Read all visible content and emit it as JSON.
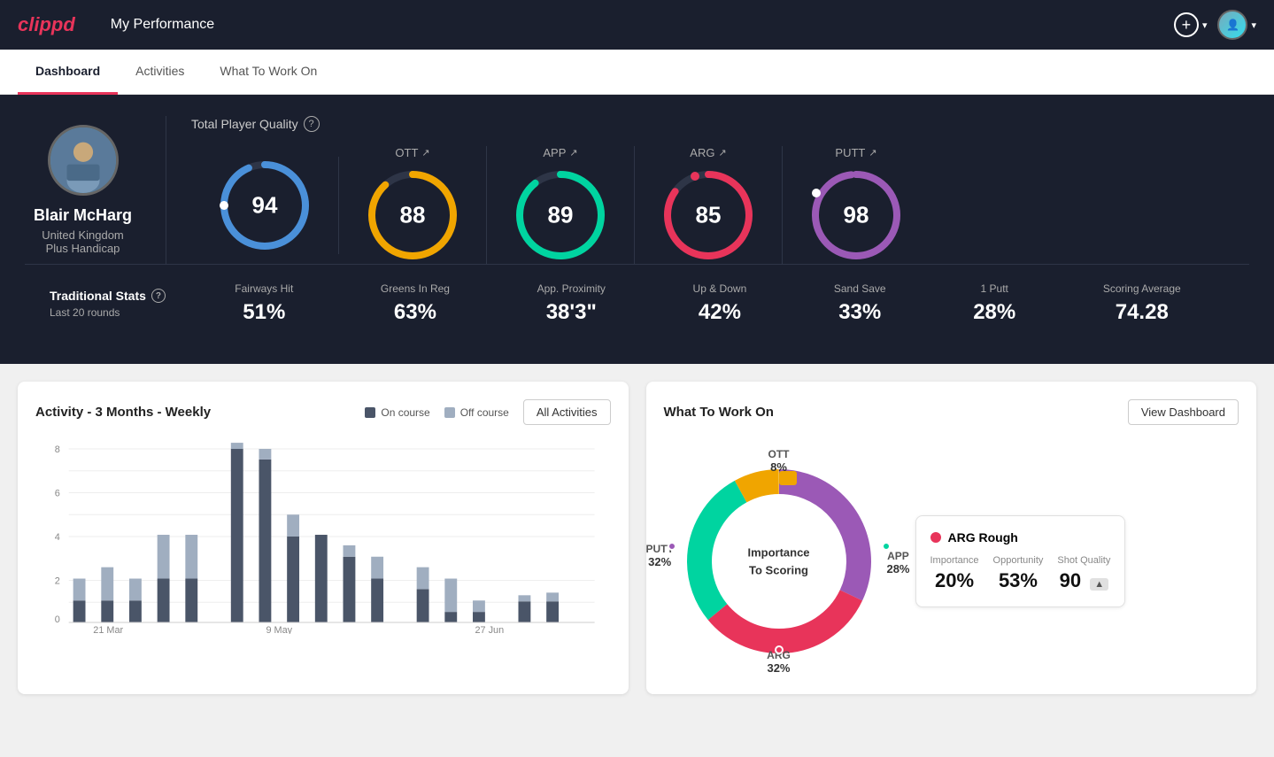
{
  "app": {
    "logo": "clippd",
    "title": "My Performance"
  },
  "nav": {
    "tabs": [
      {
        "id": "dashboard",
        "label": "Dashboard",
        "active": true
      },
      {
        "id": "activities",
        "label": "Activities",
        "active": false
      },
      {
        "id": "what-to-work-on",
        "label": "What To Work On",
        "active": false
      }
    ]
  },
  "player": {
    "name": "Blair McHarg",
    "country": "United Kingdom",
    "handicap": "Plus Handicap"
  },
  "quality": {
    "label": "Total Player Quality",
    "main_score": 94,
    "categories": [
      {
        "id": "ott",
        "label": "OTT",
        "score": 88,
        "color": "#f0a500",
        "track_color": "#3a3a3a"
      },
      {
        "id": "app",
        "label": "APP",
        "score": 89,
        "color": "#00d4a0",
        "track_color": "#3a3a3a"
      },
      {
        "id": "arg",
        "label": "ARG",
        "score": 85,
        "color": "#e8345a",
        "track_color": "#3a3a3a"
      },
      {
        "id": "putt",
        "label": "PUTT",
        "score": 98,
        "color": "#9b59b6",
        "track_color": "#3a3a3a"
      }
    ]
  },
  "traditional_stats": {
    "label": "Traditional Stats",
    "period": "Last 20 rounds",
    "stats": [
      {
        "label": "Fairways Hit",
        "value": "51%"
      },
      {
        "label": "Greens In Reg",
        "value": "63%"
      },
      {
        "label": "App. Proximity",
        "value": "38'3\""
      },
      {
        "label": "Up & Down",
        "value": "42%"
      },
      {
        "label": "Sand Save",
        "value": "33%"
      },
      {
        "label": "1 Putt",
        "value": "28%"
      },
      {
        "label": "Scoring Average",
        "value": "74.28"
      }
    ]
  },
  "activity_chart": {
    "title": "Activity - 3 Months - Weekly",
    "legend": [
      {
        "label": "On course",
        "color": "#4a5568"
      },
      {
        "label": "Off course",
        "color": "#a0aec0"
      }
    ],
    "all_activities_btn": "All Activities",
    "x_labels": [
      "21 Mar",
      "9 May",
      "27 Jun"
    ],
    "bars": [
      {
        "on": 1,
        "off": 1
      },
      {
        "on": 1,
        "off": 1.5
      },
      {
        "on": 1,
        "off": 1
      },
      {
        "on": 2,
        "off": 2
      },
      {
        "on": 2,
        "off": 2
      },
      {
        "on": 8.5,
        "off": 0.5
      },
      {
        "on": 7.5,
        "off": 0.5
      },
      {
        "on": 3.5,
        "off": 1
      },
      {
        "on": 4,
        "off": 0
      },
      {
        "on": 3,
        "off": 0.5
      },
      {
        "on": 2,
        "off": 1
      },
      {
        "on": 1.5,
        "off": 1
      },
      {
        "on": 0.5,
        "off": 1.5
      },
      {
        "on": 0.5,
        "off": 0.5
      },
      {
        "on": 0.8,
        "off": 0.3
      },
      {
        "on": 0.8,
        "off": 0.4
      }
    ],
    "y_max": 9
  },
  "what_to_work_on": {
    "title": "What To Work On",
    "view_dashboard_btn": "View Dashboard",
    "donut_center": "Importance\nTo Scoring",
    "segments": [
      {
        "label": "OTT",
        "percent": "8%",
        "color": "#f0a500"
      },
      {
        "label": "APP",
        "percent": "28%",
        "color": "#00d4a0"
      },
      {
        "label": "ARG",
        "percent": "32%",
        "color": "#e8345a"
      },
      {
        "label": "PUTT",
        "percent": "32%",
        "color": "#9b59b6"
      }
    ],
    "info_card": {
      "title": "ARG Rough",
      "dot_color": "#e8345a",
      "metrics": [
        {
          "label": "Importance",
          "value": "20%"
        },
        {
          "label": "Opportunity",
          "value": "53%"
        },
        {
          "label": "Shot Quality",
          "value": "90",
          "badge": "▲"
        }
      ]
    }
  }
}
